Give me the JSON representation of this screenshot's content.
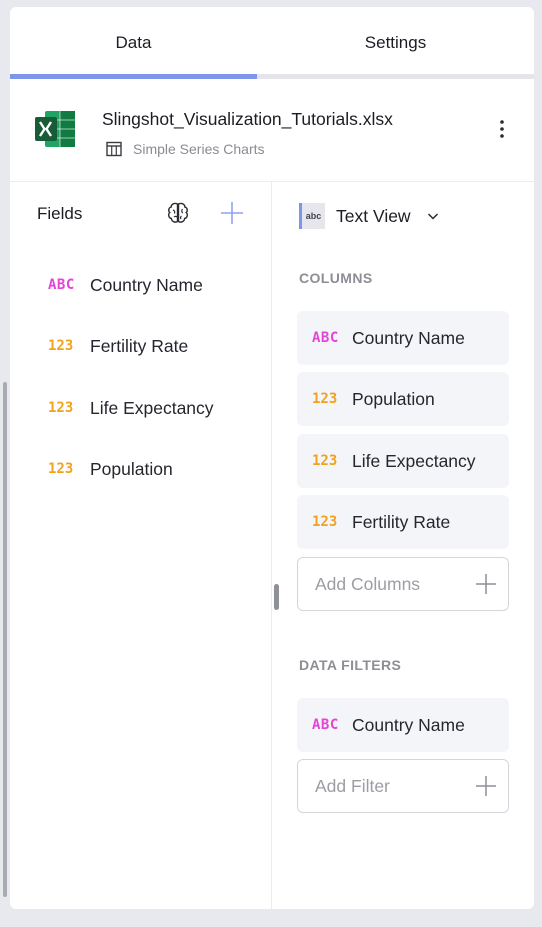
{
  "tabs": [
    {
      "label": "Data",
      "active": true
    },
    {
      "label": "Settings",
      "active": false
    }
  ],
  "file": {
    "name": "Slingshot_Visualization_Tutorials.xlsx",
    "sheet": "Simple Series Charts",
    "icon": "excel-icon"
  },
  "fields": {
    "title": "Fields",
    "items": [
      {
        "type": "ABC",
        "label": "Country Name"
      },
      {
        "type": "123",
        "label": "Fertility Rate"
      },
      {
        "type": "123",
        "label": "Life Expectancy"
      },
      {
        "type": "123",
        "label": "Population"
      }
    ]
  },
  "visualization": {
    "icon_text": "abc",
    "label": "Text View"
  },
  "columns": {
    "title": "COLUMNS",
    "items": [
      {
        "type": "ABC",
        "label": "Country Name"
      },
      {
        "type": "123",
        "label": "Population"
      },
      {
        "type": "123",
        "label": "Life Expectancy"
      },
      {
        "type": "123",
        "label": "Fertility Rate"
      }
    ],
    "add_label": "Add Columns"
  },
  "filters": {
    "title": "DATA FILTERS",
    "items": [
      {
        "type": "ABC",
        "label": "Country Name"
      }
    ],
    "add_label": "Add Filter"
  },
  "colors": {
    "accent": "#7e95ec",
    "text_type": "#e345d6",
    "number_type": "#f2a11e",
    "excel": "#1f7a44"
  }
}
